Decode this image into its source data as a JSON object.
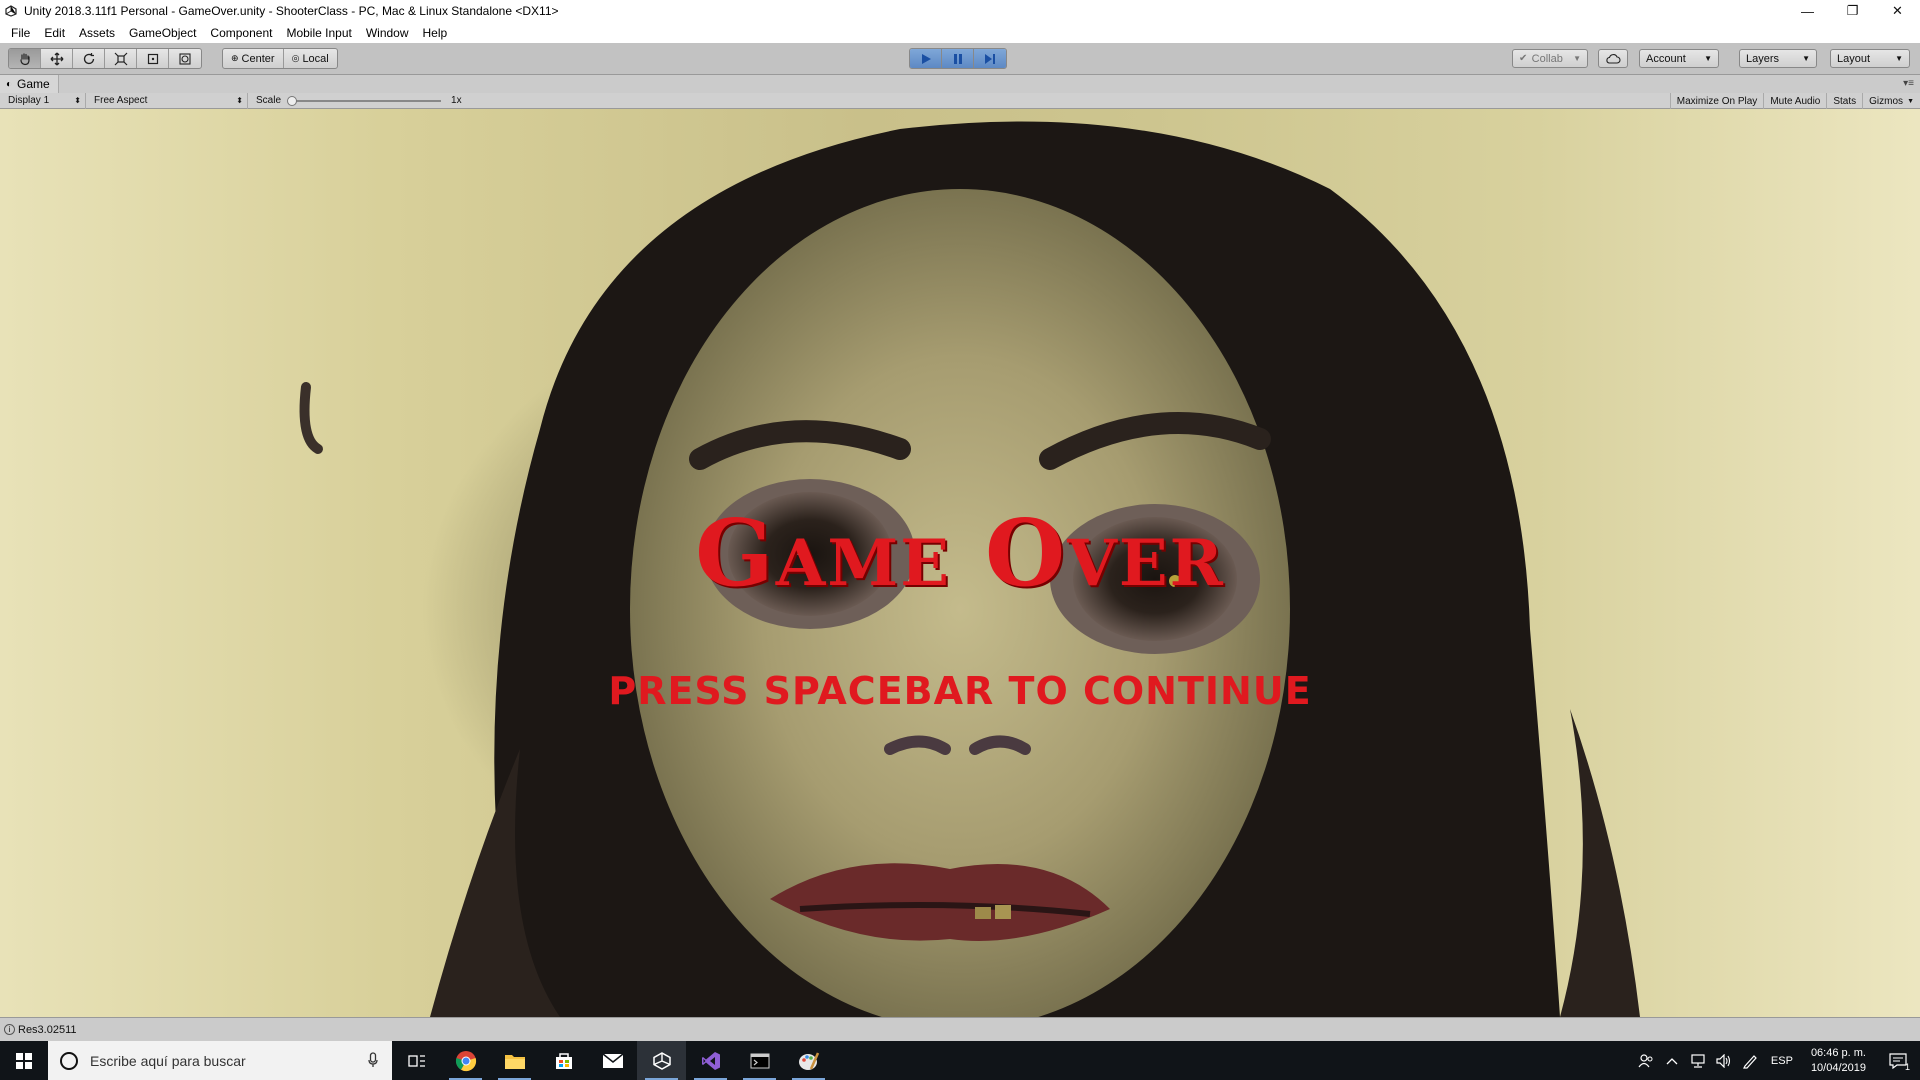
{
  "window": {
    "title": "Unity 2018.3.11f1 Personal - GameOver.unity - ShooterClass - PC, Mac & Linux Standalone <DX11>",
    "minimize": "—",
    "restore": "❐",
    "close": "✕"
  },
  "menu": [
    "File",
    "Edit",
    "Assets",
    "GameObject",
    "Component",
    "Mobile Input",
    "Window",
    "Help"
  ],
  "toolbar": {
    "tools": [
      "hand-icon",
      "move-icon",
      "rotate-icon",
      "scale-icon",
      "rect-icon",
      "transform-icon"
    ],
    "pivot_center": "Center",
    "pivot_local": "Local",
    "collab": "Collab",
    "account": "Account",
    "layers": "Layers",
    "layout": "Layout"
  },
  "game_view": {
    "tab_label": "Game",
    "display": "Display 1",
    "aspect": "Free Aspect",
    "scale_label": "Scale",
    "scale_value": "1x",
    "toggles": [
      "Maximize On Play",
      "Mute Audio",
      "Stats",
      "Gizmos"
    ]
  },
  "scene": {
    "title": "Game Over",
    "subtitle": "press spacebar to continue"
  },
  "status": {
    "message": "Res3.02511"
  },
  "taskbar": {
    "search_placeholder": "Escribe aquí para buscar",
    "apps": [
      "task-view-icon",
      "chrome-icon",
      "file-explorer-icon",
      "store-icon",
      "mail-icon",
      "unity-icon",
      "visual-studio-icon",
      "terminal-icon",
      "paint-icon"
    ],
    "language": "ESP",
    "time": "06:46 p. m.",
    "date": "10/04/2019",
    "notification_count": "1"
  },
  "colors": {
    "accent_red": "#e0191f",
    "play_blue": "#5d89c4",
    "unity_gray": "#c2c2c2",
    "taskbar": "#101418"
  }
}
